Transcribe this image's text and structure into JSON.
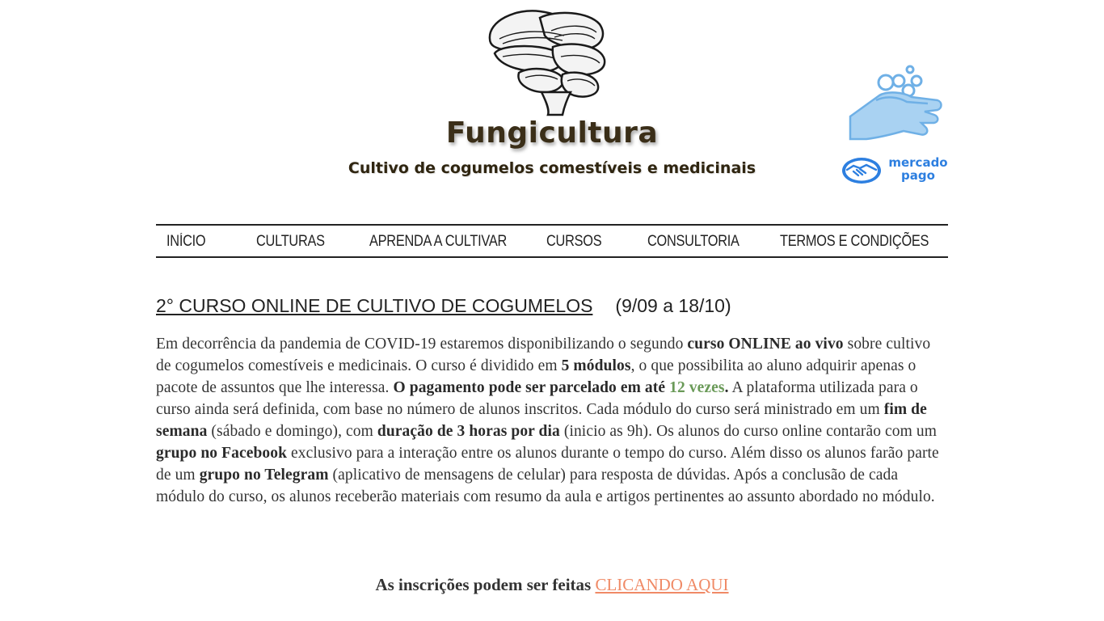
{
  "header": {
    "logo_icon": "mushroom-cluster-icon",
    "title": "Fungicultura",
    "subtitle": "Cultivo de cogumelos comestíveis e medicinais",
    "hygiene_icon": "hand-washing-icon",
    "payment_logo": {
      "icon": "handshake-icon",
      "line1": "mercado",
      "line2": "pago",
      "color": "#2d7fe0"
    }
  },
  "nav": {
    "items": [
      {
        "label": "INÍCIO"
      },
      {
        "label": "CULTURAS"
      },
      {
        "label": "APRENDA A CULTIVAR"
      },
      {
        "label": "CURSOS"
      },
      {
        "label": "CONSULTORIA"
      },
      {
        "label": "TERMOS E CONDIÇÕES"
      }
    ]
  },
  "main": {
    "heading": "2° CURSO ONLINE DE CULTIVO DE COGUMELOS",
    "heading_dates": "(9/09 a 18/10)",
    "paragraph": [
      "Em decorrência da pandemia de COVID-19 estaremos disponibilizando o segundo ",
      "curso ONLINE ao vivo",
      " sobre cultivo de cogumelos comestíveis e medicinais. O curso é dividido em ",
      "5 módulos",
      ", o que possibilita ao aluno adquirir apenas o pacote de assuntos que lhe interessa. ",
      "O pagamento pode ser parcelado em até ",
      "12 vezes",
      ".",
      " A plataforma utilizada para o curso ainda será definida, com base no número de alunos inscritos. Cada módulo do curso será ministrado em um ",
      "fim de semana",
      " (sábado e domingo), com ",
      "duração de 3 horas por dia",
      " (inicio as 9h). Os alunos do curso online contarão com um ",
      "grupo no Facebook",
      " exclusivo para a interação entre os alunos durante o tempo do curso. Além disso os alunos farão parte de um ",
      "grupo no Telegram",
      " (aplicativo de mensagens de celular) para resposta de dúvidas. Após a conclusão de cada módulo do curso, os alunos receberão materiais com resumo da aula e artigos pertinentes ao assunto abordado no módulo."
    ],
    "signup_text": "As inscrições podem ser feitas ",
    "signup_link": "CLICANDO AQUI"
  },
  "colors": {
    "accent_link": "#f08a66",
    "highlight_green": "#6a9a58",
    "title_brown": "#3a2e18"
  }
}
